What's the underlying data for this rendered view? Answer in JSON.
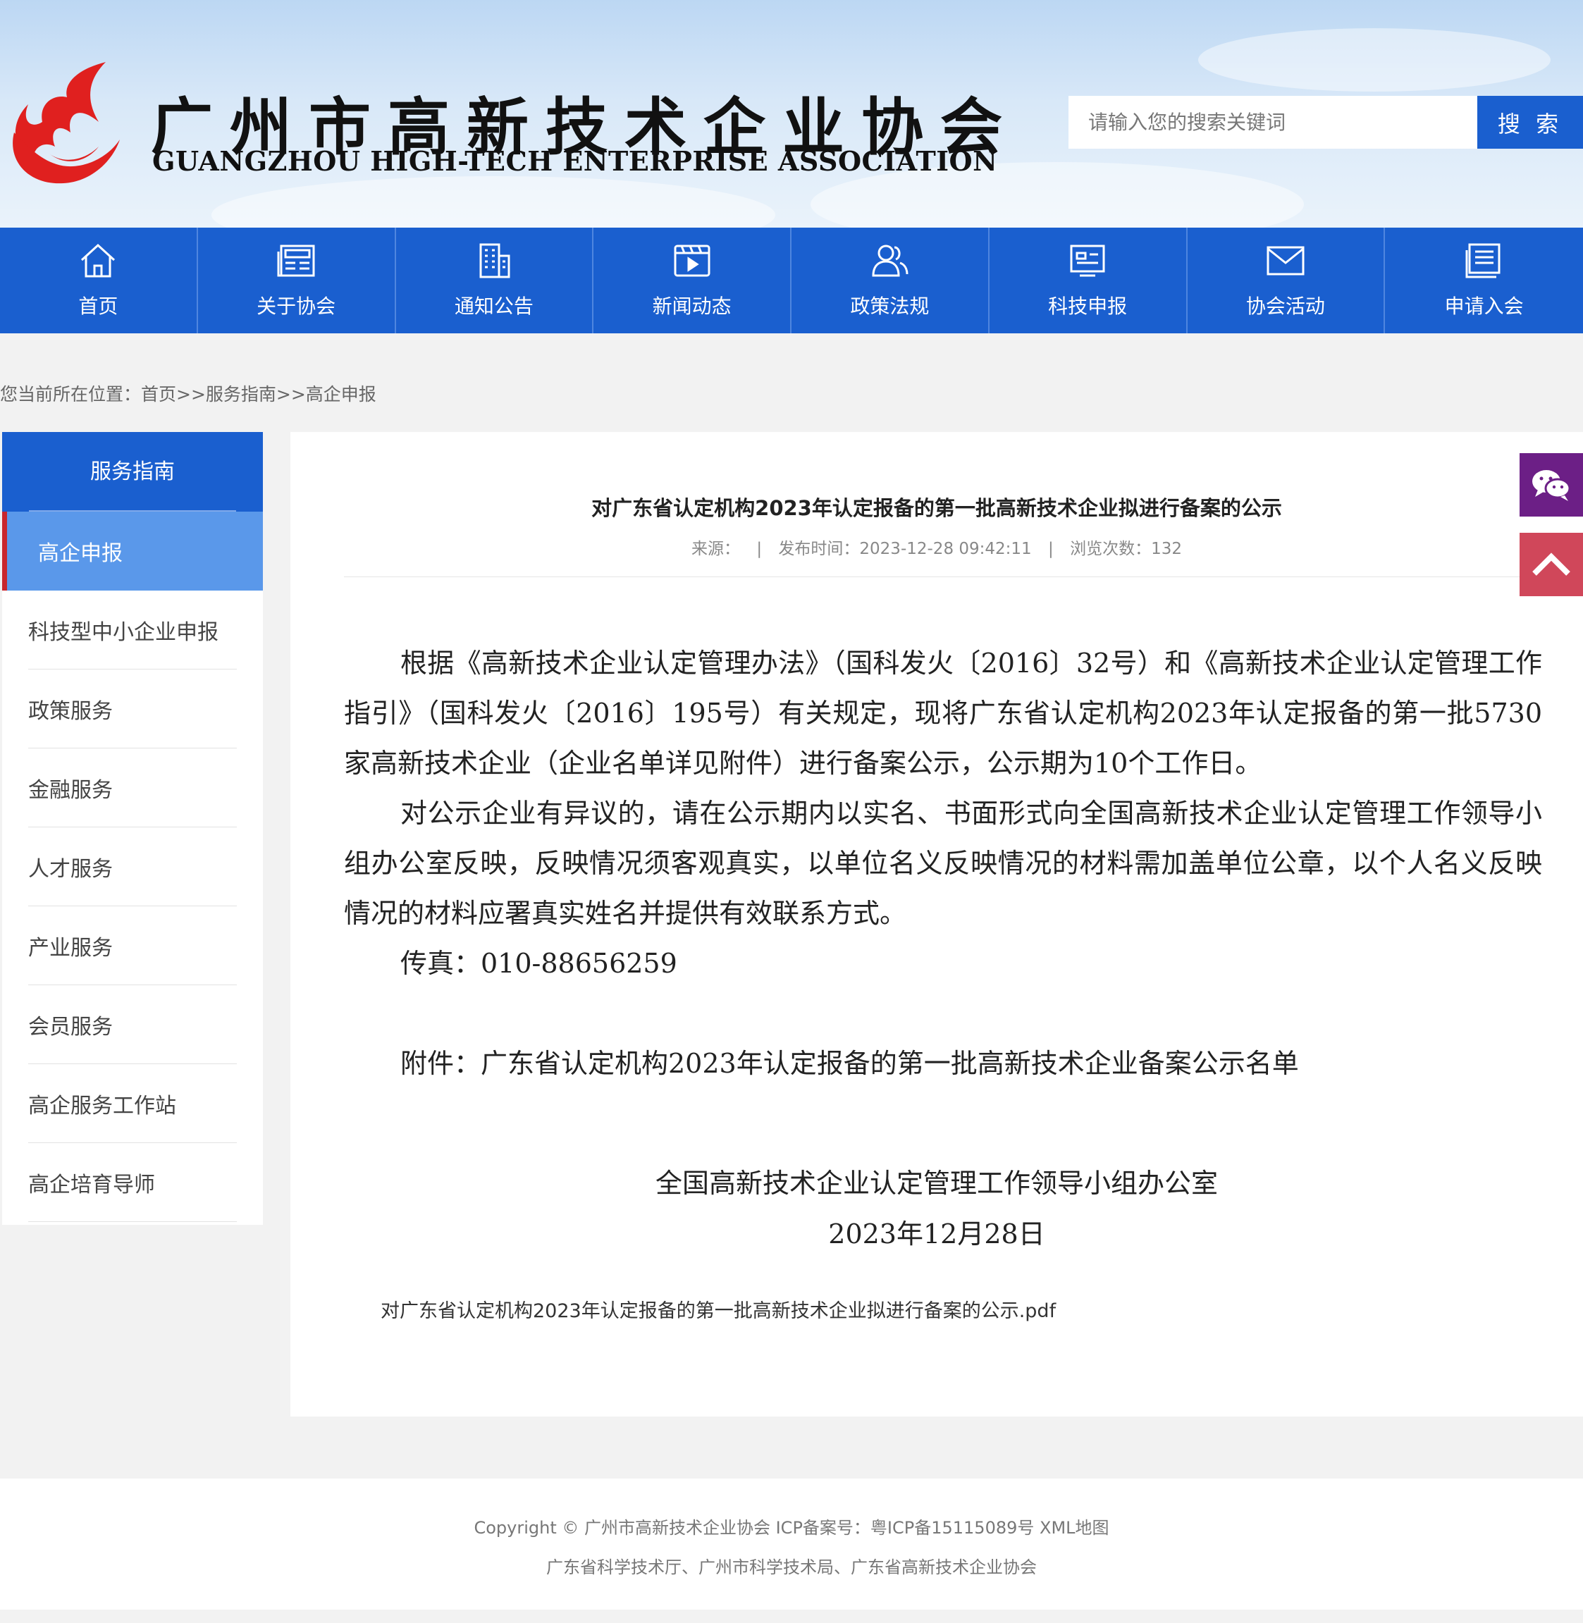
{
  "header": {
    "title": "广州市高新技术企业协会",
    "subtitle": "GUANGZHOU HIGH-TECH ENTERPRISE ASSOCIATION",
    "logo": "flame-logo",
    "search_placeholder": "请输入您的搜索关键词",
    "search_button": "搜 索"
  },
  "nav": {
    "items": [
      {
        "label": "首页",
        "icon": "home-icon"
      },
      {
        "label": "关于协会",
        "icon": "news-icon"
      },
      {
        "label": "通知公告",
        "icon": "building-icon"
      },
      {
        "label": "新闻动态",
        "icon": "video-icon"
      },
      {
        "label": "政策法规",
        "icon": "users-icon"
      },
      {
        "label": "科技申报",
        "icon": "monitor-icon"
      },
      {
        "label": "协会活动",
        "icon": "mail-icon"
      },
      {
        "label": "申请入会",
        "icon": "document-icon"
      }
    ]
  },
  "breadcrumb": {
    "prefix": "您当前所在位置：",
    "path": "首页>>服务指南>>高企申报"
  },
  "sidebar": {
    "heading": "服务指南",
    "items": [
      "高企申报",
      "科技型中小企业申报",
      "政策服务",
      "金融服务",
      "人才服务",
      "产业服务",
      "会员服务",
      "高企服务工作站",
      "高企培育导师"
    ],
    "active_index": 0
  },
  "article": {
    "title": "对广东省认定机构2023年认定报备的第一批高新技术企业拟进行备案的公示",
    "source_label": "来源：",
    "published_label": "发布时间：",
    "published": "2023-12-28 09:42:11",
    "views_label": "浏览次数：",
    "views": "132",
    "paragraph1": "根据《高新技术企业认定管理办法》（国科发火〔2016〕32号）和《高新技术企业认定管理工作指引》（国科发火〔2016〕195号）有关规定，现将广东省认定机构2023年认定报备的第一批5730家高新技术企业（企业名单详见附件）进行备案公示，公示期为10个工作日。",
    "paragraph2": "对公示企业有异议的，请在公示期内以实名、书面形式向全国高新技术企业认定管理工作领导小组办公室反映，反映情况须客观真实，以单位名义反映情况的材料需加盖单位公章，以个人名义反映情况的材料应署真实姓名并提供有效联系方式。",
    "fax": "传真：010-88656259",
    "attachment_line": "附件：广东省认定机构2023年认定报备的第一批高新技术企业备案公示名单",
    "signature_org": "全国高新技术企业认定管理工作领导小组办公室",
    "signature_date": "2023年12月28日",
    "attachment_file": "对广东省认定机构2023年认定报备的第一批高新技术企业拟进行备案的公示.pdf"
  },
  "floating": {
    "wechat_icon": "wechat-icon",
    "top_icon": "chevron-up-icon"
  },
  "footer": {
    "line1": "Copyright © 广州市高新技术企业协会 ICP备案号：粤ICP备15115089号 XML地图",
    "line2": "广东省科学技术厅、广州市科学技术局、广东省高新技术企业协会"
  },
  "colors": {
    "primary": "#1a5fcf",
    "active_side": "#5a98ea",
    "accent_red": "#c8262d",
    "wechat": "#6c1f86",
    "back_top": "#d0475a"
  }
}
